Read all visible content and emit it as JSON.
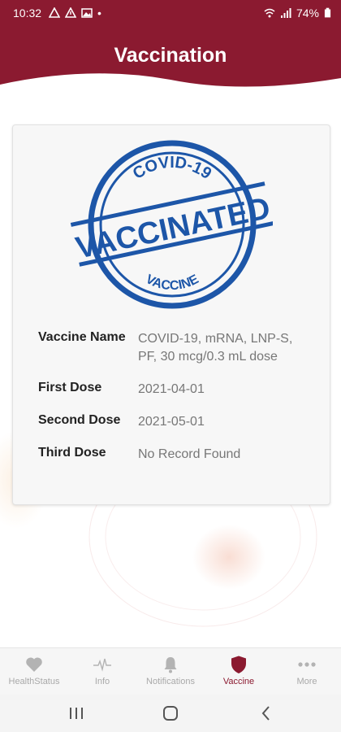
{
  "status_bar": {
    "time": "10:32",
    "battery": "74%",
    "dot": "•"
  },
  "header": {
    "title": "Vaccination",
    "color": "#8b1a30"
  },
  "stamp": {
    "top_text": "COVID-19",
    "main_text": "VACCINATED",
    "bottom_text": "VACCINE",
    "color": "#1d56a8"
  },
  "vaccine_info": {
    "rows": [
      {
        "label": "Vaccine Name",
        "value": "COVID-19, mRNA, LNP-S, PF, 30 mcg/0.3 mL dose"
      },
      {
        "label": "First Dose",
        "value": "2021-04-01"
      },
      {
        "label": "Second Dose",
        "value": "2021-05-01"
      },
      {
        "label": "Third Dose",
        "value": "No Record Found"
      }
    ]
  },
  "bottom_nav": {
    "items": [
      {
        "label": "HealthStatus",
        "icon": "heart-icon",
        "active": false
      },
      {
        "label": "Info",
        "icon": "pulse-icon",
        "active": false
      },
      {
        "label": "Notifications",
        "icon": "bell-icon",
        "active": false
      },
      {
        "label": "Vaccine",
        "icon": "shield-icon",
        "active": true
      },
      {
        "label": "More",
        "icon": "more-dots-icon",
        "active": false
      }
    ]
  },
  "system_nav": {
    "icons": [
      "recents-icon",
      "home-icon",
      "back-icon"
    ]
  }
}
